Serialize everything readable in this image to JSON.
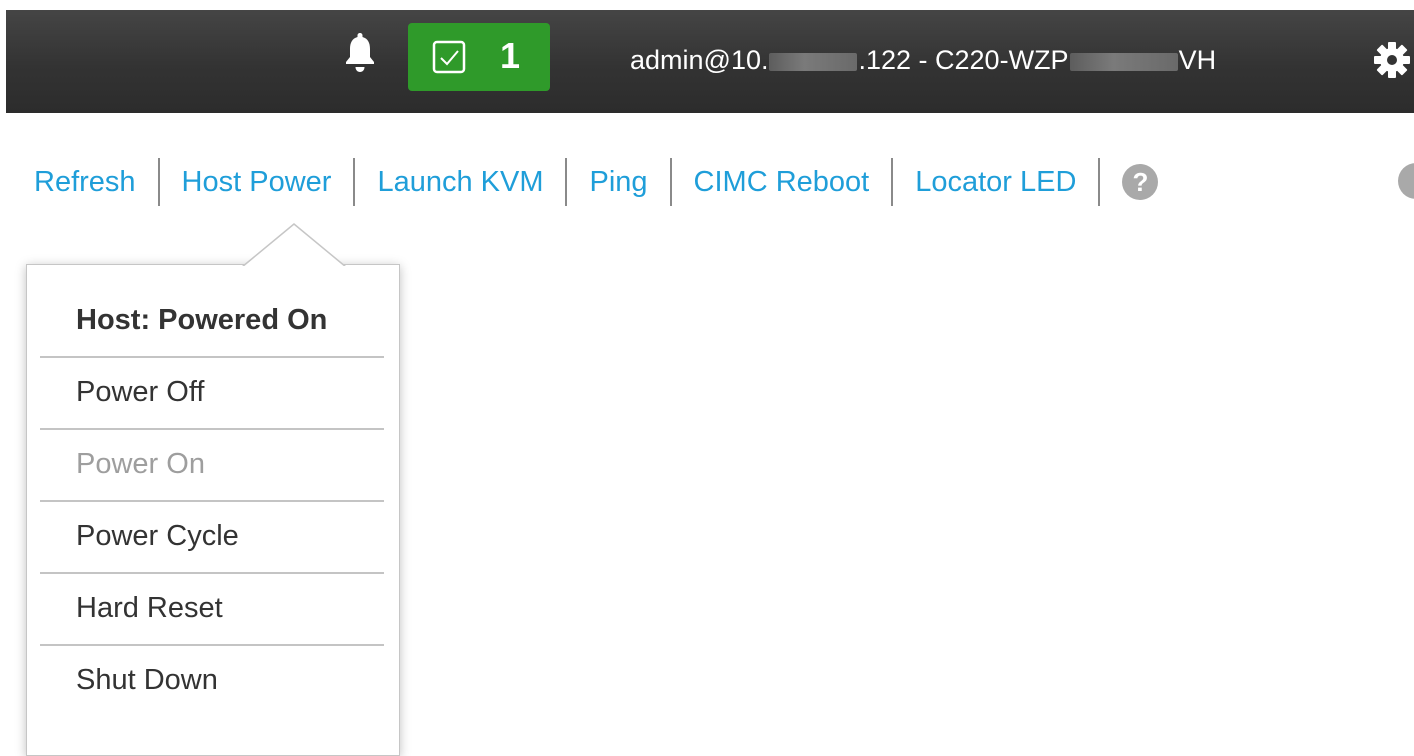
{
  "header": {
    "notification_icon": "bell-icon",
    "alert_icon": "checkbox-check-icon",
    "alert_count": "1",
    "alert_color": "#2f9a2a",
    "user_prefix": "admin@10.",
    "user_middle": ".122 - C220-WZP",
    "user_suffix": "VH",
    "settings_icon": "gear-icon"
  },
  "toolbar": {
    "items": [
      {
        "label": "Refresh"
      },
      {
        "label": "Host Power"
      },
      {
        "label": "Launch KVM"
      },
      {
        "label": "Ping"
      },
      {
        "label": "CIMC Reboot"
      },
      {
        "label": "Locator LED"
      }
    ],
    "help_icon_glyph": "?",
    "link_color": "#1f9ed9"
  },
  "host_power_menu": {
    "status": "Host: Powered On",
    "items": [
      {
        "label": "Power Off",
        "enabled": true
      },
      {
        "label": "Power On",
        "enabled": false
      },
      {
        "label": "Power Cycle",
        "enabled": true
      },
      {
        "label": "Hard Reset",
        "enabled": true
      },
      {
        "label": "Shut Down",
        "enabled": true
      }
    ]
  }
}
